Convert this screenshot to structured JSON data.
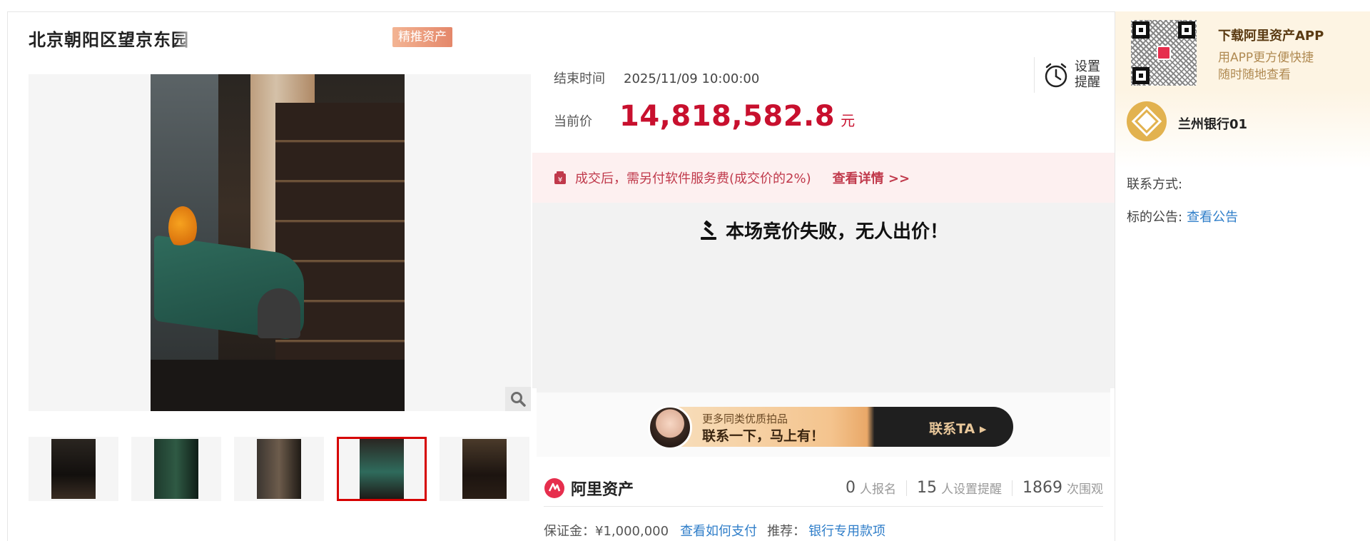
{
  "listing": {
    "title": "北京朝阳区望京东园",
    "badge": "精推资产"
  },
  "gallery": {
    "zoom_icon": "magnifier-icon",
    "thumbnails": [
      {
        "label": "thumbnail-1"
      },
      {
        "label": "thumbnail-2"
      },
      {
        "label": "thumbnail-3"
      },
      {
        "label": "thumbnail-4",
        "active": true
      },
      {
        "label": "thumbnail-5"
      }
    ]
  },
  "auction": {
    "end_time_label": "结束时间",
    "end_time_value": "2025/11/09 10:00:00",
    "reminder_label": "设置提醒",
    "current_price_label": "当前价",
    "current_price_value": "14,818,582.8",
    "price_unit": "元",
    "fee_notice": "成交后，需另付软件服务费(成交价的2%)",
    "fee_link": "查看详情 >>",
    "result_message": "本场竞价失败，无人出价！"
  },
  "promo": {
    "line1": "更多同类优质拍品",
    "line2": "联系一下，马上有！",
    "cta": "联系TA"
  },
  "stats": {
    "brand": "阿里资产",
    "signups_count": "0",
    "signups_label": "人报名",
    "reminders_count": "15",
    "reminders_label": "人设置提醒",
    "views_count": "1869",
    "views_label": "次围观"
  },
  "deposit": {
    "label": "保证金：¥1,000,000",
    "pay_link": "查看如何支付",
    "recommend_label": "推荐：",
    "recommend_link": "银行专用款项"
  },
  "sidebar": {
    "app_title": "下载阿里资产APP",
    "app_sub1": "用APP更方便快捷",
    "app_sub2": "随时随地查看",
    "bank_name": "兰州银行01",
    "contact_label": "联系方式:",
    "announcement_label": "标的公告:",
    "announcement_link": "查看公告"
  },
  "colors": {
    "price_red": "#c8102e",
    "link_blue": "#2f7ec9",
    "notice_bg": "#fdf0f0",
    "app_box_bg": "#fdf4e3"
  }
}
